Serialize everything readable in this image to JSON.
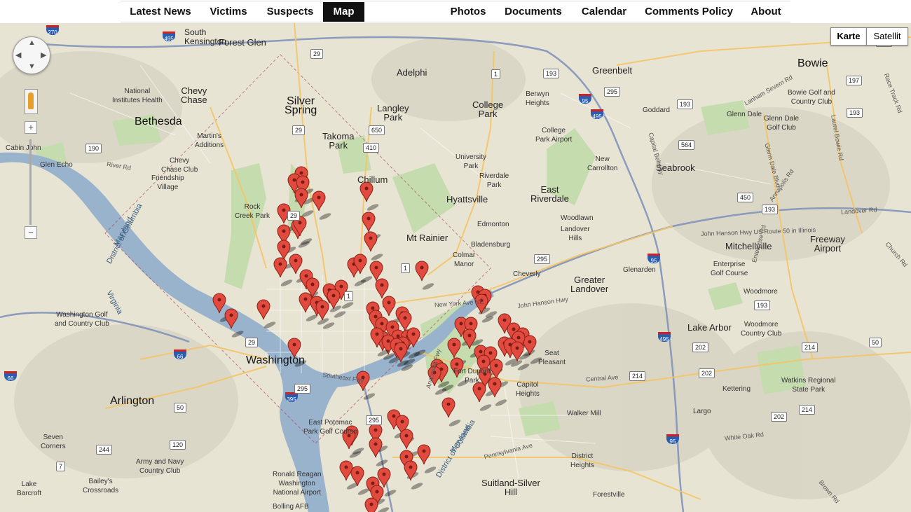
{
  "nav": {
    "items": [
      "Latest News",
      "Victims",
      "Suspects",
      "Map",
      "Photos",
      "Documents",
      "Calendar",
      "Comments Policy",
      "About"
    ],
    "active": "Map"
  },
  "map_controls": {
    "zoom_in": "+",
    "zoom_out": "−",
    "type_map": "Karte",
    "type_satellite": "Satellit",
    "selected_type": "Karte"
  },
  "map_labels": {
    "south_kensington": "South\nKensington",
    "forest_glen": "Forest Glen",
    "adelphi": "Adelphi",
    "greenbelt": "Greenbelt",
    "bowie": "Bowie",
    "national_inst": "National\nInstitutes Health",
    "chevy_chase": "Chevy\nChase",
    "silver_spring": "Silver\nSpring",
    "langley_park": "Langley\nPark",
    "college_park": "College\nPark",
    "berwyn_heights": "Berwyn\nHeights",
    "goddard": "Goddard",
    "glenn_dale": "Glenn Dale",
    "bowie_golf": "Bowie Golf and\nCountry Club",
    "bethesda": "Bethesda",
    "martins_additions": "Martin's\nAdditions",
    "takoma_park": "Takoma\nPark",
    "college_park_airport": "College\nPark Airport",
    "glenn_dale_golf": "Glenn Dale\nGolf Club",
    "cabin_john": "Cabin John",
    "glen_echo": "Glen Echo",
    "river_rd": "River Rd",
    "chevy_chase_club": "Chevy\nChase Club",
    "university_park": "University\nPark",
    "new_carrollton": "New\nCarrollton",
    "seabrook": "Seabrook",
    "friendship_village": "Friendship\nVillage",
    "chillum": "Chillum",
    "riverdale_park": "Riverdale\nPark",
    "rock_creek_park": "Rock\nCreek Park",
    "hyattsville": "Hyattsville",
    "east_riverdale": "East\nRiverdale",
    "woodlawn": "Woodlawn",
    "landover_hills": "Landover\nHills",
    "edmonton": "Edmonton",
    "mt_rainier": "Mt Rainier",
    "bladensburg": "Bladensburg",
    "mitchellville": "Mitchellville",
    "freeway_airport": "Freeway\nAirport",
    "colmar_manor": "Colmar\nManor",
    "cheverly": "Cheverly",
    "enterprise_golf": "Enterprise\nGolf Course",
    "glenarden": "Glenarden",
    "greater_landover": "Greater\nLandover",
    "woodmore": "Woodmore",
    "new_york_ave": "New York Ave NE",
    "john_hanson": "John Hanson Hwy",
    "washington_golf": "Washington Golf\nand Country Club",
    "lake_arbor": "Lake Arbor",
    "woodmore_country": "Woodmore\nCountry Club",
    "washington": "Washington",
    "seat_pleasant": "Seat\nPleasant",
    "fort_dupont": "Fort Dupont\nPark",
    "capitol_heights": "Capitol\nHeights",
    "central_ave": "Central Ave",
    "kettering": "Kettering",
    "watkins": "Watkins Regional\nState Park",
    "arlington": "Arlington",
    "largo": "Largo",
    "walker_mill": "Walker Mill",
    "east_potomac": "East Potomac\nPark Golf Course",
    "seven_corners": "Seven\nCorners",
    "white_oak": "White Oak Rd",
    "army_navy": "Army and Navy\nCountry Club",
    "district_heights": "District\nHeights",
    "ronald_reagan": "Ronald Reagan\nWashington\nNational Airport",
    "bailey": "Bailey's\nCrossroads",
    "lake_barcroft": "Lake\nBarcroft",
    "suitland": "Suitland-Silver\nHill",
    "forestville": "Forestville",
    "bolling": "Bolling AFB",
    "southeast_fwy": "Southeast Fwy",
    "pennsylvania_ave": "Pennsylvania Ave",
    "capital_beltway": "Capital Beltway",
    "district_of_columbia": "District of Columbia",
    "maryland": "Maryland",
    "virginia": "Virginia",
    "maryland_se": "Maryland",
    "district_se": "District of Columbia",
    "anacostia": "Anacostia Fwy",
    "john_hanson_us50": "John Hanson Hwy US Route 50 in Illinois",
    "brown_rd": "Brown Rd",
    "enterprise_rd": "Enterprise Rd",
    "lanham_severn": "Lanham Severn Rd",
    "annapolis_rd": "Annapolis Rd",
    "glenn_dale_blvd": "Glenn Dale Blvd",
    "church_rd": "Church Rd",
    "laurel_bowie": "Laurel Bowie Rd",
    "race_track": "Race Track Rd",
    "landover_rd": "Landover Rd"
  },
  "route_shields": {
    "r270": "270",
    "r495a": "495",
    "r29a": "29",
    "r1a": "1",
    "r193a": "193",
    "r295a": "295",
    "r95a": "95",
    "r495b": "495",
    "r197": "197",
    "r193b": "193",
    "r193c": "193",
    "r564": "564",
    "r190": "190",
    "r29b": "29",
    "r650": "650",
    "r410": "410",
    "r29c": "29",
    "r450": "450",
    "r193d": "193",
    "r1b": "1",
    "r295b": "295",
    "r95b": "95",
    "r202a": "202",
    "r214a": "214",
    "r50": "50",
    "r193e": "193",
    "r66a": "66",
    "r29d": "29",
    "r1c": "1",
    "r214b": "214",
    "r202b": "202",
    "r395": "395",
    "r50b": "50",
    "r295c": "295",
    "r95c": "95",
    "r214c": "214",
    "r202c": "202",
    "r495c": "495",
    "r120": "120",
    "r7": "7",
    "r244": "244",
    "r66b": "66",
    "r193f": "193",
    "r295d": "295"
  },
  "marker_color": "#e14b3f",
  "marker_count": 98
}
